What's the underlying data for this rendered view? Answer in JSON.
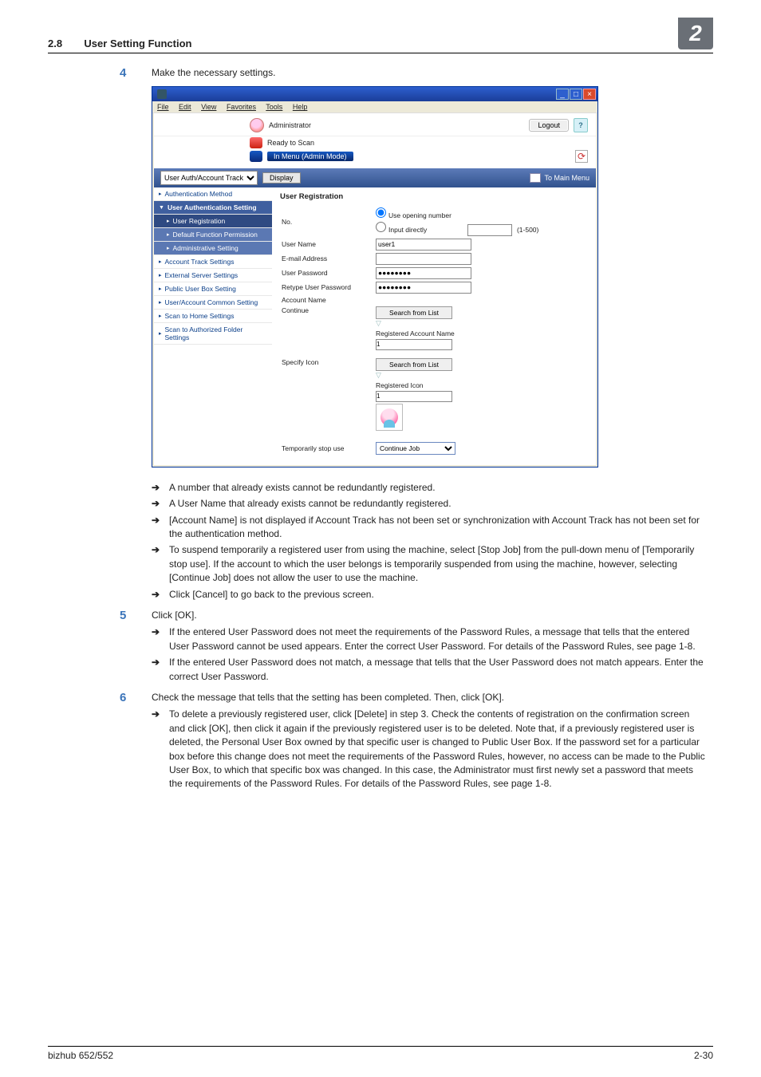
{
  "header": {
    "section_num": "2.8",
    "section_title": "User Setting Function",
    "chapter_num": "2"
  },
  "steps": {
    "s4": {
      "num": "4",
      "text": "Make the necessary settings.",
      "subs": {
        "a": "A number that already exists cannot be redundantly registered.",
        "b": "A User Name that already exists cannot be redundantly registered.",
        "c": "[Account Name] is not displayed if Account Track has not been set or synchronization with Account Track has not been set for the authentication method.",
        "d": "To suspend temporarily a registered user from using the machine, select [Stop Job] from the pull-down menu of [Temporarily stop use]. If the account to which the user belongs is temporarily suspended from using the machine, however, selecting [Continue Job] does not allow the user to use the machine.",
        "e": "Click [Cancel] to go back to the previous screen."
      }
    },
    "s5": {
      "num": "5",
      "text": "Click [OK].",
      "subs": {
        "a": "If the entered User Password does not meet the requirements of the Password Rules, a message that tells that the entered User Password cannot be used appears. Enter the correct User Password. For details of the Password Rules, see page 1-8.",
        "b": "If the entered User Password does not match, a message that tells that the User Password does not match appears. Enter the correct User Password."
      }
    },
    "s6": {
      "num": "6",
      "text": "Check the message that tells that the setting has been completed. Then, click [OK].",
      "subs": {
        "a": "To delete a previously registered user, click [Delete] in step 3. Check the contents of registration on the confirmation screen and click [OK], then click it again if the previously registered user is to be deleted. Note that, if a previously registered user is deleted, the Personal User Box owned by that specific user is changed to Public User Box. If the password set for a particular box before this change does not meet the requirements of the Password Rules, however, no access can be made to the Public User Box, to which that specific box was changed. In this case, the Administrator must first newly set a password that meets the requirements of the Password Rules. For details of the Password Rules, see page 1-8."
      }
    }
  },
  "screenshot": {
    "menubar": {
      "file": "File",
      "edit": "Edit",
      "view": "View",
      "favorites": "Favorites",
      "tools": "Tools",
      "help": "Help"
    },
    "admin_label": "Administrator",
    "logout": "Logout",
    "help_mark": "?",
    "status1": "Ready to Scan",
    "status2": "In Menu (Admin Mode)",
    "nav_select": "User Auth/Account Track",
    "nav_display": "Display",
    "to_main": "To Main Menu",
    "leftnav": {
      "i0": "Authentication Method",
      "i1": "User Authentication Setting",
      "i2": "User Registration",
      "i3": "Default Function Permission",
      "i4": "Administrative Setting",
      "i5": "Account Track Settings",
      "i6": "External Server Settings",
      "i7": "Public User Box Setting",
      "i8": "User/Account Common Setting",
      "i9": "Scan to Home Settings",
      "i10": "Scan to Authorized Folder Settings"
    },
    "form": {
      "title": "User Registration",
      "no_label": "No.",
      "radio_open": "Use opening number",
      "radio_input": "Input directly",
      "no_hint": "(1-500)",
      "user_name_label": "User Name",
      "user_name_value": "user1",
      "email_label": "E-mail Address",
      "pwd_label": "User Password",
      "pwd_value": "●●●●●●●●",
      "pwd2_label": "Retype User Password",
      "pwd2_value": "●●●●●●●●",
      "acct_label": "Account Name",
      "continue_label": "Continue",
      "search_btn": "Search from List",
      "reg_acct_label": "Registered Account Name",
      "reg_acct_value": "1",
      "spec_icon_label": "Specify Icon",
      "reg_icon_label": "Registered Icon",
      "reg_icon_value": "1",
      "temp_label": "Temporarily stop use",
      "temp_value": "Continue Job"
    }
  },
  "footer": {
    "left": "bizhub 652/552",
    "right": "2-30"
  }
}
